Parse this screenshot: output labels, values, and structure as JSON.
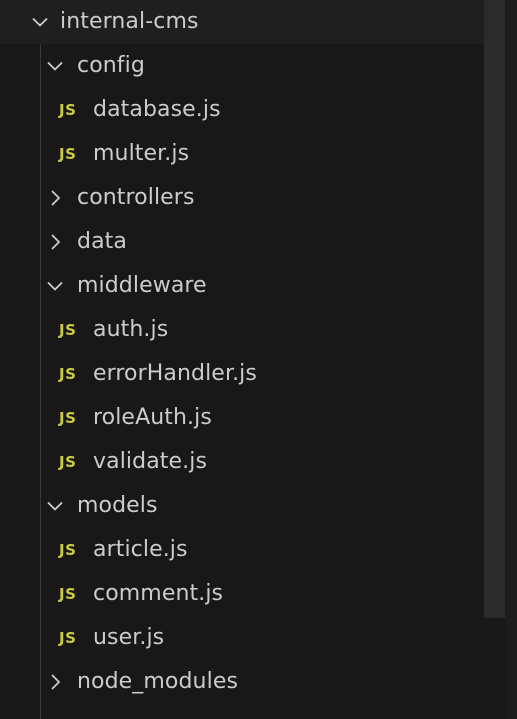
{
  "explorer": {
    "root": {
      "label": "internal-cms",
      "state": "expanded"
    },
    "config": {
      "label": "config",
      "state": "expanded",
      "files": [
        "database.js",
        "multer.js"
      ]
    },
    "controllers": {
      "label": "controllers",
      "state": "collapsed"
    },
    "data": {
      "label": "data",
      "state": "collapsed"
    },
    "middleware": {
      "label": "middleware",
      "state": "expanded",
      "files": [
        "auth.js",
        "errorHandler.js",
        "roleAuth.js",
        "validate.js"
      ]
    },
    "models": {
      "label": "models",
      "state": "expanded",
      "files": [
        "article.js",
        "comment.js",
        "user.js"
      ]
    },
    "node_modules": {
      "label": "node_modules",
      "state": "collapsed"
    },
    "js_badge": "JS"
  },
  "colors": {
    "background": "#181818",
    "text": "#cccccc",
    "js_icon": "#cbcb41",
    "scrollbar_thumb": "#2b2b2b"
  },
  "icons": {
    "expanded": "chevron-down-icon",
    "collapsed": "chevron-right-icon",
    "file": "javascript-file-icon"
  }
}
